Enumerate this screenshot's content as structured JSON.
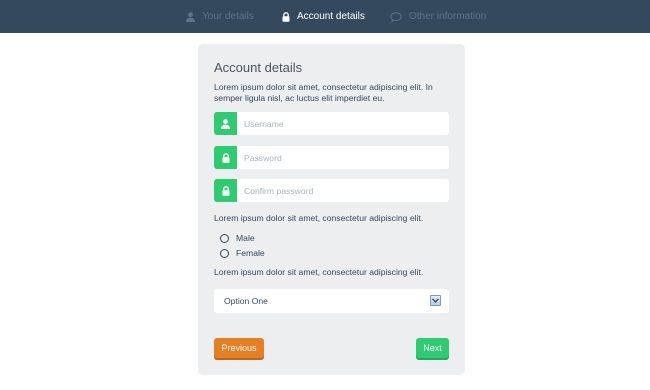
{
  "wizard": {
    "steps": [
      {
        "label": "Your details",
        "icon": "user-icon",
        "state": "inactive"
      },
      {
        "label": "Account details",
        "icon": "lock-icon",
        "state": "active"
      },
      {
        "label": "Other information",
        "icon": "chat-bubble-icon",
        "state": "inactive"
      }
    ]
  },
  "form": {
    "title": "Account details",
    "description": "Lorem ipsum dolor sit amet, consectetur adipiscing elit. In semper ligula nisl, ac luctus elit imperdiet eu.",
    "fields": {
      "username": {
        "placeholder": "Username",
        "icon": "user-icon"
      },
      "password": {
        "placeholder": "Password",
        "icon": "lock-icon"
      },
      "confirm_password": {
        "placeholder": "Confirm password",
        "icon": "lock-icon"
      }
    },
    "gender_prompt": "Lorem ipsum dolor sit amet, consectetur adipiscing elit.",
    "gender_options": [
      "Male",
      "Female"
    ],
    "select_prompt": "Lorem ipsum dolor sit amet, consectetur adipiscing elit.",
    "select_value": "Option One",
    "previous_label": "Previous",
    "next_label": "Next"
  },
  "colors": {
    "topbar": "#34495e",
    "accent_green": "#2ecc71",
    "accent_orange": "#e67e22",
    "card_bg": "#eceef0"
  }
}
